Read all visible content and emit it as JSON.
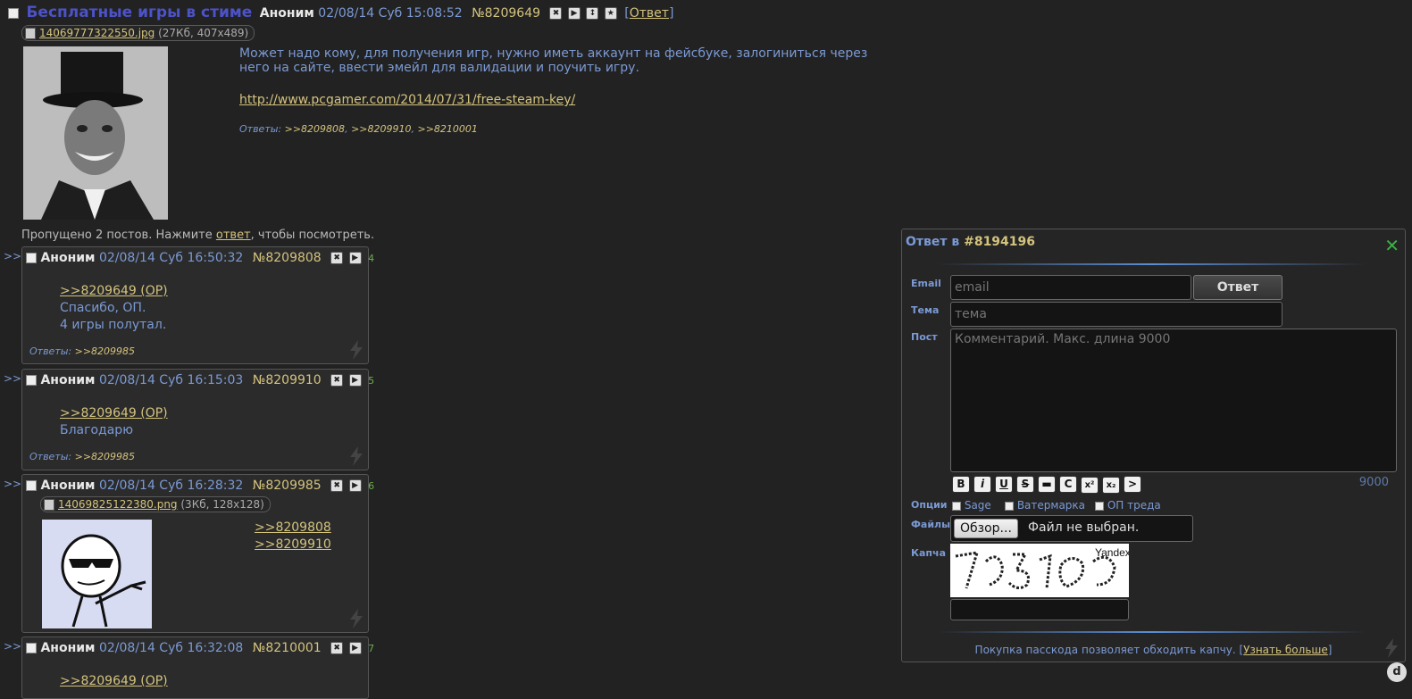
{
  "op": {
    "title": "Бесплатные игры в стиме",
    "name": "Аноним",
    "date": "02/08/14 Суб 15:08:52",
    "num": "№8209649",
    "reply_link": "Ответ",
    "file_name": "14069777322550.jpg",
    "file_meta": "(27Кб, 407x489)",
    "text1": "Может надо кому, для получения игр, нужно иметь аккаунт на фейсбуке, залогиниться через него на сайте, ввести эмейл для валидации и поучить игру.",
    "link": "http://www.pcgamer.com/2014/07/31/free-steam-key/",
    "replies_label": "Ответы:",
    "replies": [
      ">>8209808",
      ">>8209910",
      ">>8210001"
    ]
  },
  "skipped": {
    "pre": "Пропущено 2 постов. Нажмите ",
    "link": "ответ",
    "post": ", чтобы посмотреть."
  },
  "marker": ">>",
  "posts": [
    {
      "name": "Аноним",
      "date": "02/08/14 Суб 16:50:32",
      "num": "№8209808",
      "count": "4",
      "lines": [
        ">>8209649 (OP)",
        "Спасибо, ОП.",
        "4 игры полутал."
      ],
      "replies_label": "Ответы:",
      "replies": ">>8209985"
    },
    {
      "name": "Аноним",
      "date": "02/08/14 Суб 16:15:03",
      "num": "№8209910",
      "count": "5",
      "lines": [
        ">>8209649 (OP)",
        "Благодарю"
      ],
      "replies_label": "Ответы:",
      "replies": ">>8209985"
    },
    {
      "name": "Аноним",
      "date": "02/08/14 Суб 16:28:32",
      "num": "№8209985",
      "count": "6",
      "file_name": "14069825122380.png",
      "file_meta": "(3Кб, 128x128)",
      "lines": [
        ">>8209808",
        ">>8209910"
      ]
    },
    {
      "name": "Аноним",
      "date": "02/08/14 Суб 16:32:08",
      "num": "№8210001",
      "count": "7",
      "lines": [
        ">>8209649 (OP)"
      ]
    }
  ],
  "form": {
    "title_prefix": "Ответ в",
    "title_num": "#8194196",
    "email_label": "Email",
    "email_placeholder": "email",
    "submit": "Ответ",
    "subject_label": "Тема",
    "subject_placeholder": "тема",
    "post_label": "Пост",
    "post_placeholder": "Комментарий. Макс. длина 9000",
    "format_buttons": [
      "B",
      "i",
      "U",
      "S",
      "▬",
      "C",
      "x²",
      "x₂",
      ">"
    ],
    "counter": "9000",
    "options_label": "Опции",
    "options": [
      "Sage",
      "Ватермарка",
      "ОП треда"
    ],
    "files_label": "Файлы",
    "browse": "Обзор...",
    "no_file": "Файл не выбран.",
    "captcha_label": "Капча",
    "captcha_brand": "Yandex",
    "passcode_text": "Покупка пасскода позволяет обходить капчу. [",
    "passcode_link": "Узнать больше",
    "passcode_end": "]"
  },
  "colors": {
    "background": "#222222",
    "accent": "#7b9ad4",
    "link": "#d4c37d",
    "title": "#4c52c8"
  }
}
